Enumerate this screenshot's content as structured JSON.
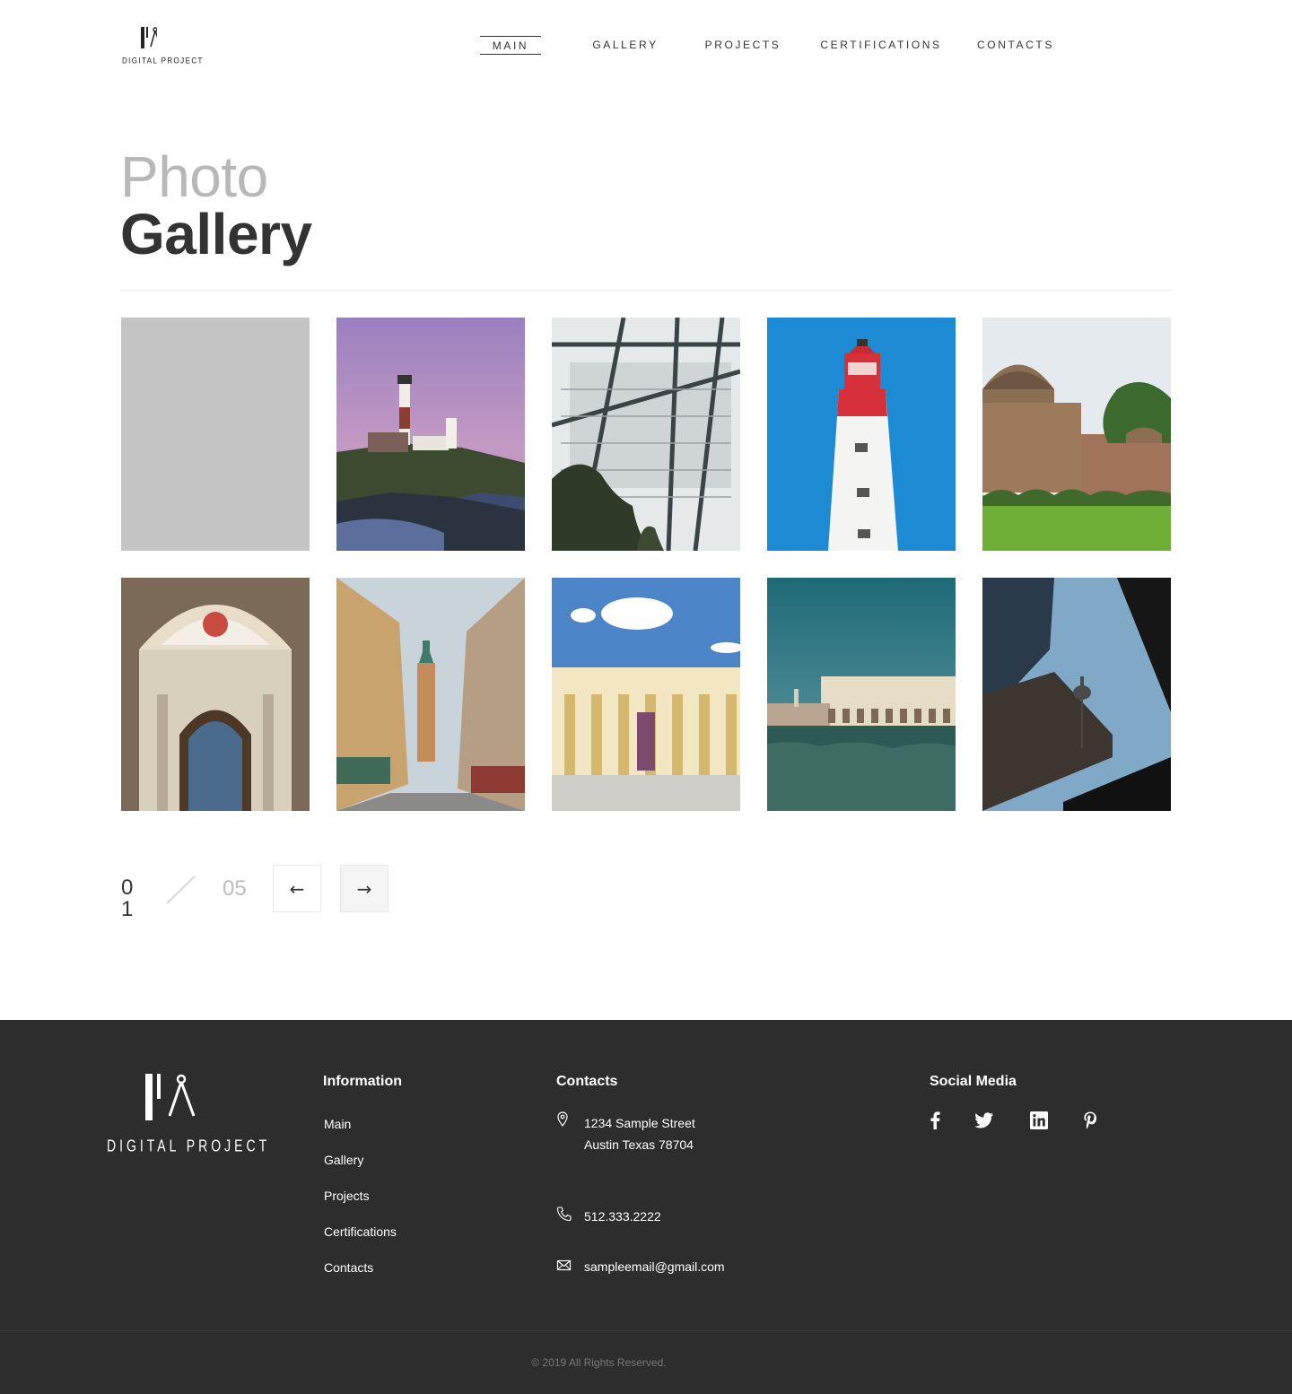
{
  "brand": {
    "logo_text": "DIGITAL PROJECT"
  },
  "nav": {
    "items": [
      {
        "label": "MAIN",
        "active": true
      },
      {
        "label": "GALLERY",
        "active": false
      },
      {
        "label": "PROJECTS",
        "active": false
      },
      {
        "label": "CERTIFICATIONS",
        "active": false
      },
      {
        "label": "CONTACTS",
        "active": false
      }
    ]
  },
  "page": {
    "title_light": "Photo",
    "title_bold": "Gallery"
  },
  "gallery": {
    "images": [
      {
        "name": "placeholder"
      },
      {
        "name": "lighthouse-sunset"
      },
      {
        "name": "greenhouse-roof"
      },
      {
        "name": "red-white-lighthouse"
      },
      {
        "name": "tomb-monument"
      },
      {
        "name": "church-altar"
      },
      {
        "name": "city-street-tower"
      },
      {
        "name": "colonnade-building"
      },
      {
        "name": "venice-palace"
      },
      {
        "name": "skyscrapers-tower"
      }
    ]
  },
  "pagination": {
    "current": "01",
    "total": "05",
    "prev_label": "←",
    "next_label": "→"
  },
  "footer": {
    "information": {
      "heading": "Information",
      "links": [
        "Main",
        "Gallery",
        "Projects",
        "Certifications",
        "Contacts"
      ]
    },
    "contacts": {
      "heading": "Contacts",
      "address_line1": "1234 Sample Street",
      "address_line2": "Austin Texas 78704",
      "phone": "512.333.2222",
      "email": "sampleemail@gmail.com"
    },
    "social": {
      "heading": "Social Media",
      "icons": [
        "facebook-icon",
        "twitter-icon",
        "linkedin-icon",
        "pinterest-icon"
      ]
    },
    "copyright": "© 2019 All Rights Reserved."
  },
  "colors": {
    "footer_bg": "#2d2d2d",
    "text_dark": "#333333",
    "title_light": "#b8b8b8"
  }
}
